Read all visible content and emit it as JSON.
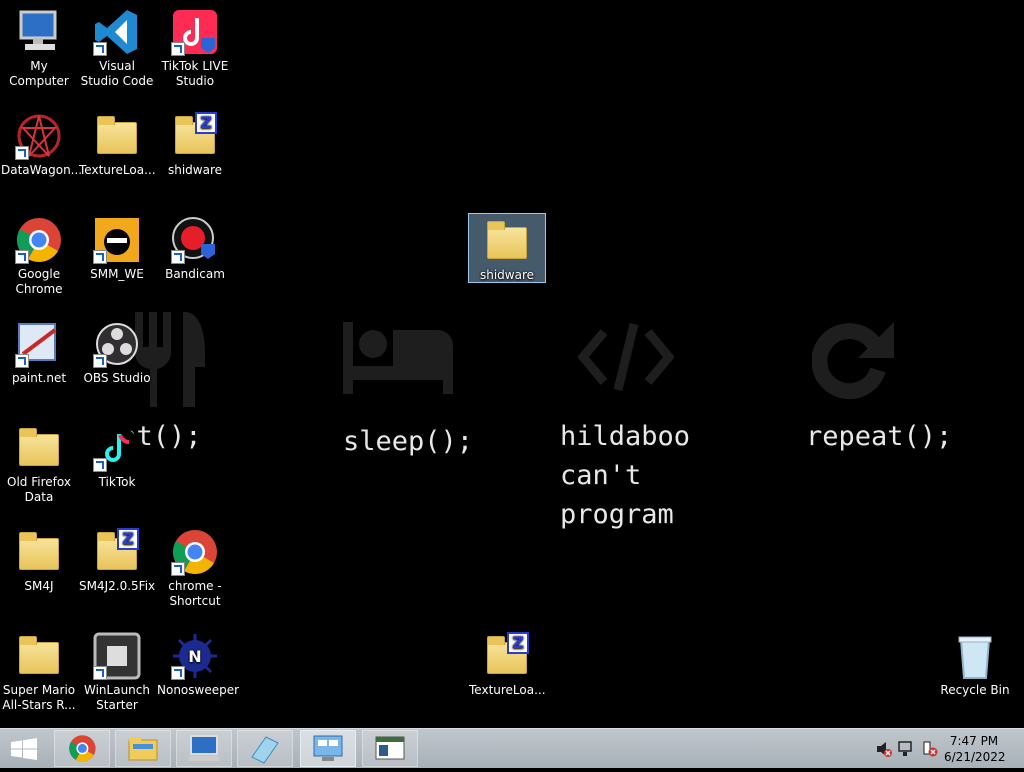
{
  "desktop": {
    "icons": [
      {
        "label": "My Computer"
      },
      {
        "label": "Visual Studio Code"
      },
      {
        "label": "TikTok LIVE Studio"
      },
      {
        "label": "DataWagon..."
      },
      {
        "label": "TextureLoa..."
      },
      {
        "label": "shidware"
      },
      {
        "label": "Google Chrome"
      },
      {
        "label": "SMM_WE"
      },
      {
        "label": "Bandicam"
      },
      {
        "label": "paint.net"
      },
      {
        "label": "OBS Studio"
      },
      {
        "label": "Old Firefox Data"
      },
      {
        "label": "TikTok"
      },
      {
        "label": "SM4J"
      },
      {
        "label": "SM4J2.0.5Fix"
      },
      {
        "label": "chrome - Shortcut"
      },
      {
        "label": "Super Mario All-Stars R..."
      },
      {
        "label": "WinLaunch Starter"
      },
      {
        "label": "Nonosweeper"
      },
      {
        "label": "shidware"
      },
      {
        "label": "TextureLoa..."
      },
      {
        "label": "Recycle Bin"
      }
    ]
  },
  "wallpaper": {
    "texts": [
      "eat();",
      "sleep();",
      "hildaboo\ncan't\nprogram",
      "repeat();"
    ],
    "icons": [
      "fork-knife-icon",
      "bed-icon",
      "code-icon",
      "redo-icon"
    ]
  },
  "taskbar": {
    "buttons": [
      "windows-start-icon",
      "chrome-icon",
      "file-explorer-icon",
      "computer-icon",
      "paint-icon",
      "remote-desktop-icon",
      "window-icon"
    ],
    "tray_icons": [
      "speaker-muted-icon",
      "network-icon",
      "action-center-icon"
    ],
    "time": "7:47 PM",
    "date": "6/21/2022"
  },
  "colors": {
    "selection": "#99c9ef",
    "zip_badge": "#2a3cd0",
    "chrome_red": "#db4437",
    "chrome_green": "#0f9d58",
    "chrome_yellow": "#f4b400",
    "chrome_blue": "#4285f4"
  }
}
